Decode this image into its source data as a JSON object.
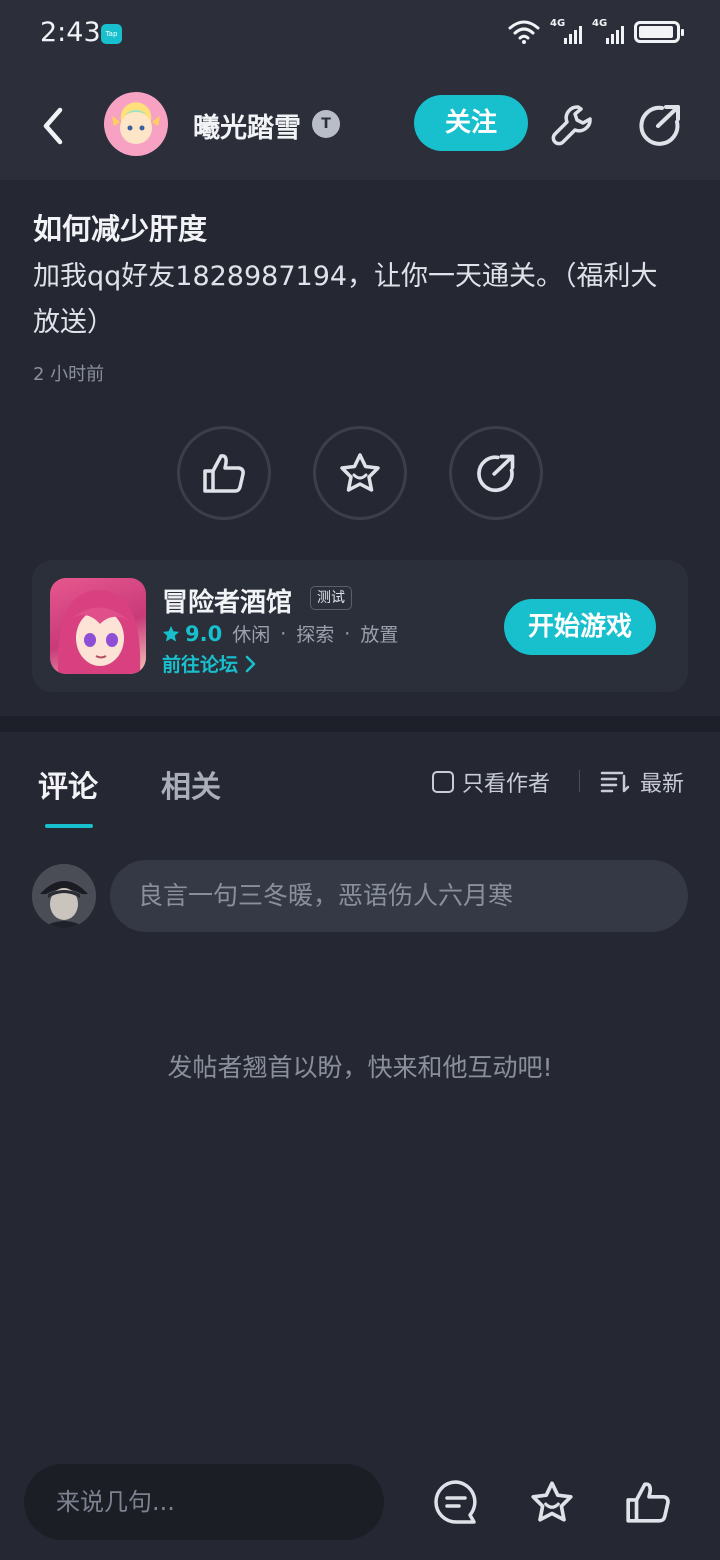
{
  "status_bar": {
    "time": "2:43",
    "app_badge": "Tap",
    "network_1": "4G",
    "network_2": "4G"
  },
  "header": {
    "author_name": "曦光踏雪",
    "verify_badge": "T",
    "follow_label": "关注"
  },
  "post": {
    "title": "如何减少肝度",
    "body": "加我qq好友1828987194，让你一天通关。（福利大放送）",
    "time": "2 小时前"
  },
  "game_card": {
    "name": "冒险者酒馆",
    "tag": "测试",
    "rating": "9.0",
    "genres": [
      "休闲",
      "探索",
      "放置"
    ],
    "separator": "·",
    "forum_link": "前往论坛",
    "play_label": "开始游戏"
  },
  "comments_section": {
    "tabs": [
      {
        "label": "评论",
        "active": true
      },
      {
        "label": "相关",
        "active": false
      }
    ],
    "author_only_label": "只看作者",
    "sort_label": "最新",
    "input_placeholder": "良言一句三冬暖，恶语伤人六月寒",
    "empty_hint": "发帖者翘首以盼，快来和他互动吧!"
  },
  "bottom_bar": {
    "input_placeholder": "来说几句..."
  },
  "colors": {
    "accent": "#17c0cc",
    "background": "#252833",
    "header_bg": "#2c2f3a"
  },
  "icons": {
    "back": "chevron-left-icon",
    "wrench": "wrench-icon",
    "share": "share-icon",
    "like": "thumbs-up-icon",
    "favorite": "star-icon",
    "comment": "comment-bubble-icon"
  }
}
